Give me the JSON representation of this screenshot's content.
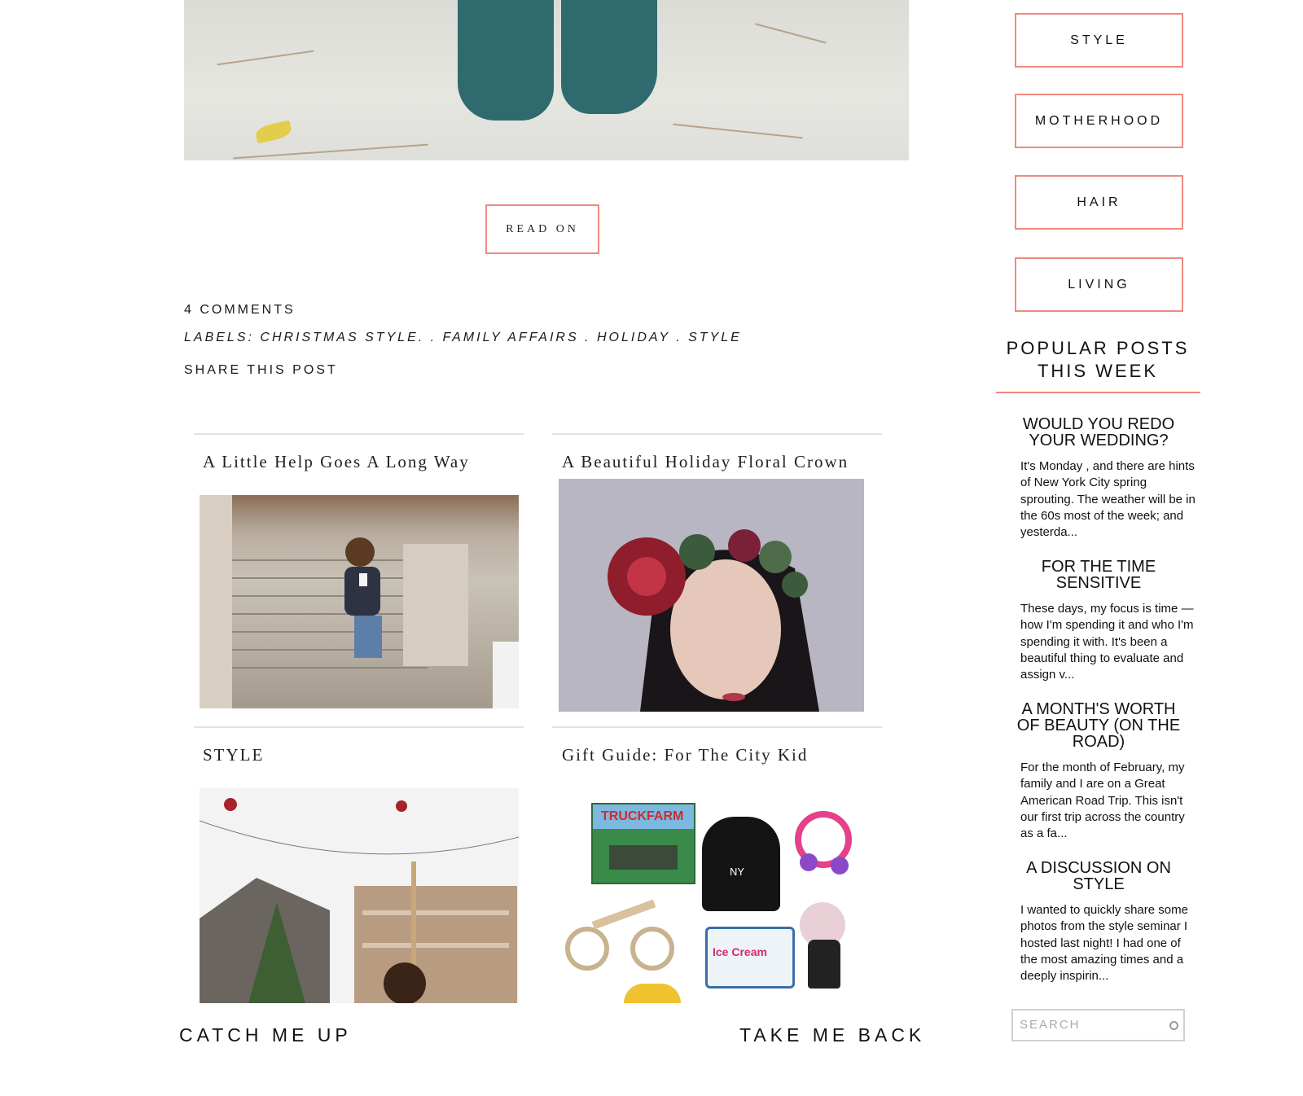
{
  "post": {
    "read_on_label": "READ ON",
    "comments": "4 COMMENTS",
    "labels_prefix": "LABELS:",
    "labels": [
      "CHRISTMAS STYLE.",
      ". FAMILY AFFAIRS",
      ". HOLIDAY",
      ". STYLE"
    ],
    "share_label": "SHARE THIS POST"
  },
  "related": [
    {
      "title": "A Little Help Goes A Long Way"
    },
    {
      "title": "A Beautiful Holiday Floral Crown"
    },
    {
      "title": "STYLE"
    },
    {
      "title": "Gift Guide: For The City Kid"
    }
  ],
  "gift_guide": {
    "book_title": "TRUCKFARM",
    "hoodie_text": "NY",
    "truck_text": "Ice Cream"
  },
  "pagination": {
    "newer_label": "CATCH ME UP",
    "older_label": "TAKE ME BACK"
  },
  "sidebar": {
    "categories": [
      "STYLE",
      "MOTHERHOOD",
      "HAIR",
      "LIVING"
    ],
    "popular_title_line1": "POPULAR POSTS",
    "popular_title_line2": "THIS WEEK",
    "popular_posts": [
      {
        "title": "WOULD YOU REDO YOUR WEDDING?",
        "excerpt": "It's  Monday , and there are hints of New York City spring sprouting. The weather will be in the 60s most of the week; and yesterda..."
      },
      {
        "title": "FOR THE TIME SENSITIVE",
        "excerpt": "These days, my focus is time —how I'm spending it and who I'm spending it with. It's been a beautiful thing to evaluate and assign v..."
      },
      {
        "title": "A MONTH'S WORTH OF BEAUTY (ON THE ROAD)",
        "excerpt": "For the month of February, my family and I are on a Great American Road Trip. This isn't our first trip across the country as a fa..."
      },
      {
        "title": "A DISCUSSION ON STYLE",
        "excerpt": "I wanted to quickly share some photos from the style seminar I hosted last night! I had one of the most amazing times and a deeply inspirin..."
      }
    ],
    "search_placeholder": "SEARCH"
  },
  "colors": {
    "accent_coral": "#f08a80",
    "boot_teal": "#2f6a6f",
    "rule_gray": "#e2e2e2"
  }
}
